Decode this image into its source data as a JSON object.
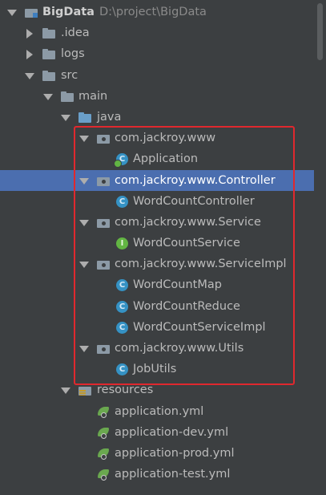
{
  "tree": {
    "root": {
      "label": "BigData",
      "path": "D:\\project\\BigData"
    },
    "items": [
      {
        "label": "BigData"
      },
      {
        "label": ".idea"
      },
      {
        "label": "logs"
      },
      {
        "label": "src"
      },
      {
        "label": "main"
      },
      {
        "label": "java"
      },
      {
        "label": "com.jackroy.www"
      },
      {
        "label": "Application"
      },
      {
        "label": "com.jackroy.www.Controller"
      },
      {
        "label": "WordCountController"
      },
      {
        "label": "com.jackroy.www.Service"
      },
      {
        "label": "WordCountService"
      },
      {
        "label": "com.jackroy.www.ServiceImpl"
      },
      {
        "label": "WordCountMap"
      },
      {
        "label": "WordCountReduce"
      },
      {
        "label": "WordCountServiceImpl"
      },
      {
        "label": "com.jackroy.www.Utils"
      },
      {
        "label": "JobUtils"
      },
      {
        "label": "resources"
      },
      {
        "label": "application.yml"
      },
      {
        "label": "application-dev.yml"
      },
      {
        "label": "application-prod.yml"
      },
      {
        "label": "application-test.yml"
      }
    ],
    "selected": "com.jackroy.www.Controller",
    "icon_glyphs": {
      "class": "C",
      "interface": "I"
    }
  },
  "colors": {
    "background": "#3c3f41",
    "selection": "#4b6eaf",
    "highlight_box": "#e0282e",
    "class_icon": "#3592c4",
    "interface_icon": "#62b543"
  }
}
